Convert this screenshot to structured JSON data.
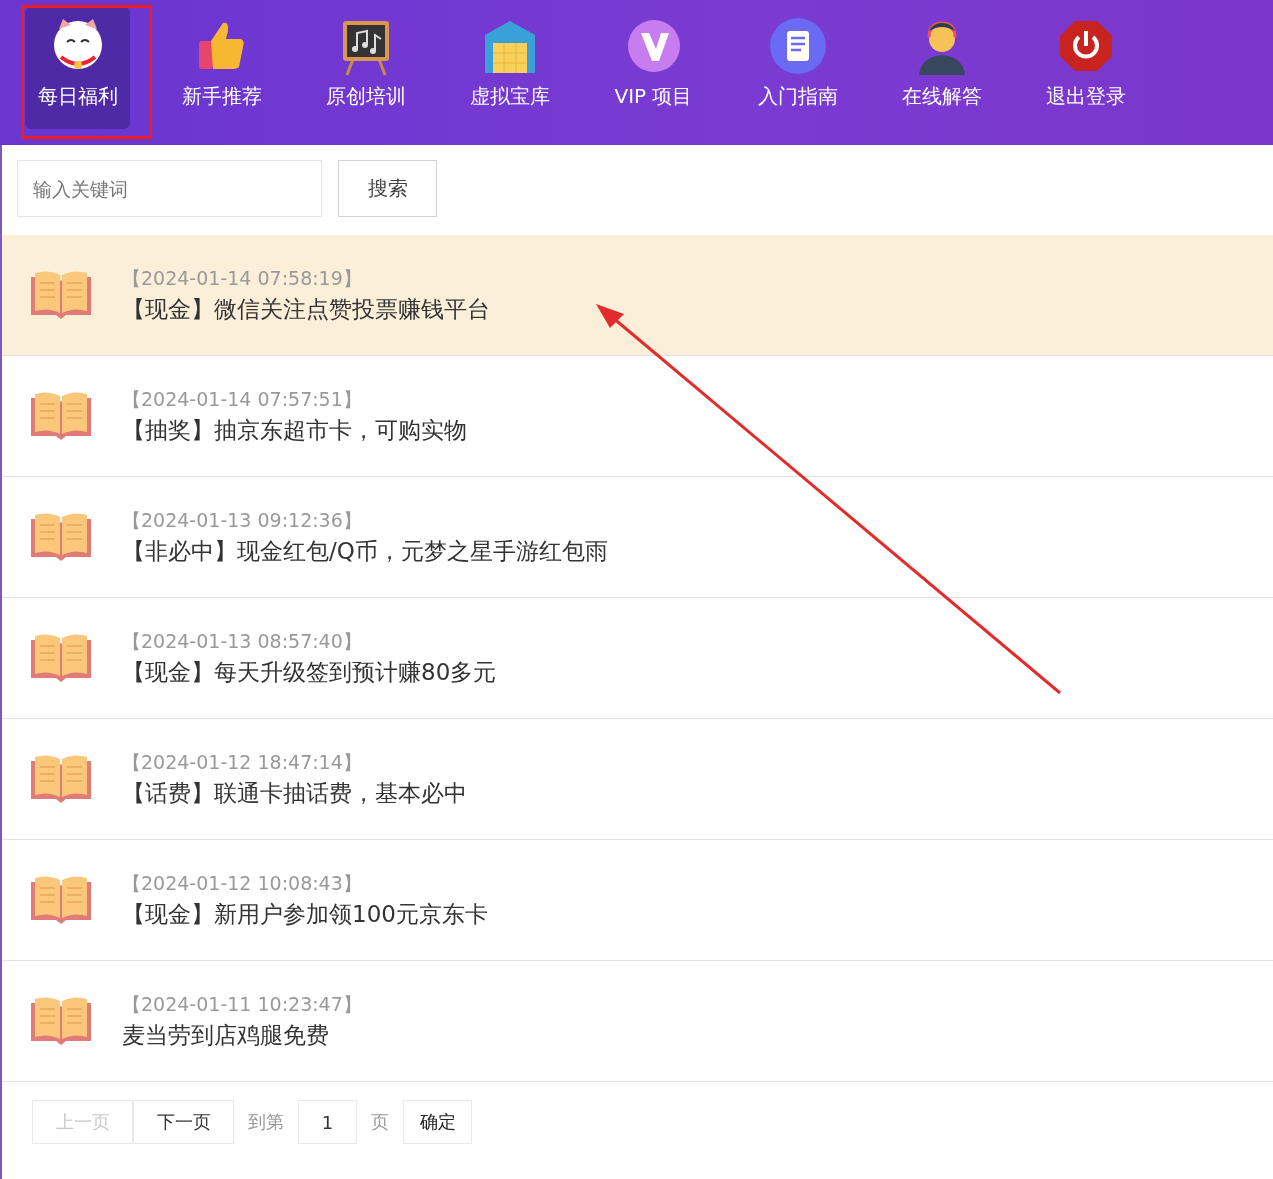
{
  "nav": [
    {
      "label": "每日福利",
      "kind": "cat",
      "selected": true
    },
    {
      "label": "新手推荐",
      "kind": "thumb",
      "selected": false
    },
    {
      "label": "原创培训",
      "kind": "board",
      "selected": false
    },
    {
      "label": "虚拟宝库",
      "kind": "warehouse",
      "selected": false
    },
    {
      "label": "VIP 项目",
      "kind": "vip",
      "selected": false
    },
    {
      "label": "入门指南",
      "kind": "doc",
      "selected": false
    },
    {
      "label": "在线解答",
      "kind": "agent",
      "selected": false
    },
    {
      "label": "退出登录",
      "kind": "power",
      "selected": false
    }
  ],
  "search": {
    "placeholder": "输入关键词",
    "button": "搜索"
  },
  "posts": [
    {
      "time": "【2024-01-14 07:58:19】",
      "title": "【现金】微信关注点赞投票赚钱平台",
      "selected": true
    },
    {
      "time": "【2024-01-14 07:57:51】",
      "title": "【抽奖】抽京东超市卡，可购实物",
      "selected": false
    },
    {
      "time": "【2024-01-13 09:12:36】",
      "title": "【非必中】现金红包/Q币，元梦之星手游红包雨",
      "selected": false
    },
    {
      "time": "【2024-01-13 08:57:40】",
      "title": "【现金】每天升级签到预计赚80多元",
      "selected": false
    },
    {
      "time": "【2024-01-12 18:47:14】",
      "title": "【话费】联通卡抽话费，基本必中",
      "selected": false
    },
    {
      "time": "【2024-01-12 10:08:43】",
      "title": "【现金】新用户参加领100元京东卡",
      "selected": false
    },
    {
      "time": "【2024-01-11 10:23:47】",
      "title": "麦当劳到店鸡腿免费",
      "selected": false
    }
  ],
  "pagination": {
    "prev": {
      "label": "上一页",
      "disabled": true
    },
    "next": {
      "label": "下一页",
      "disabled": false
    },
    "goto": "到第",
    "page": "1",
    "unit": "页",
    "confirm": "确定"
  }
}
